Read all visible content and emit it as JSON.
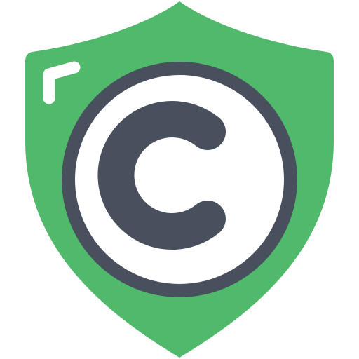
{
  "icon": {
    "name": "copyright-shield-icon",
    "colors": {
      "shield": "#51B96B",
      "highlight": "#FFFFFF",
      "ring": "#48505E",
      "disc": "#FFFFFF",
      "letter": "#48505E"
    }
  }
}
